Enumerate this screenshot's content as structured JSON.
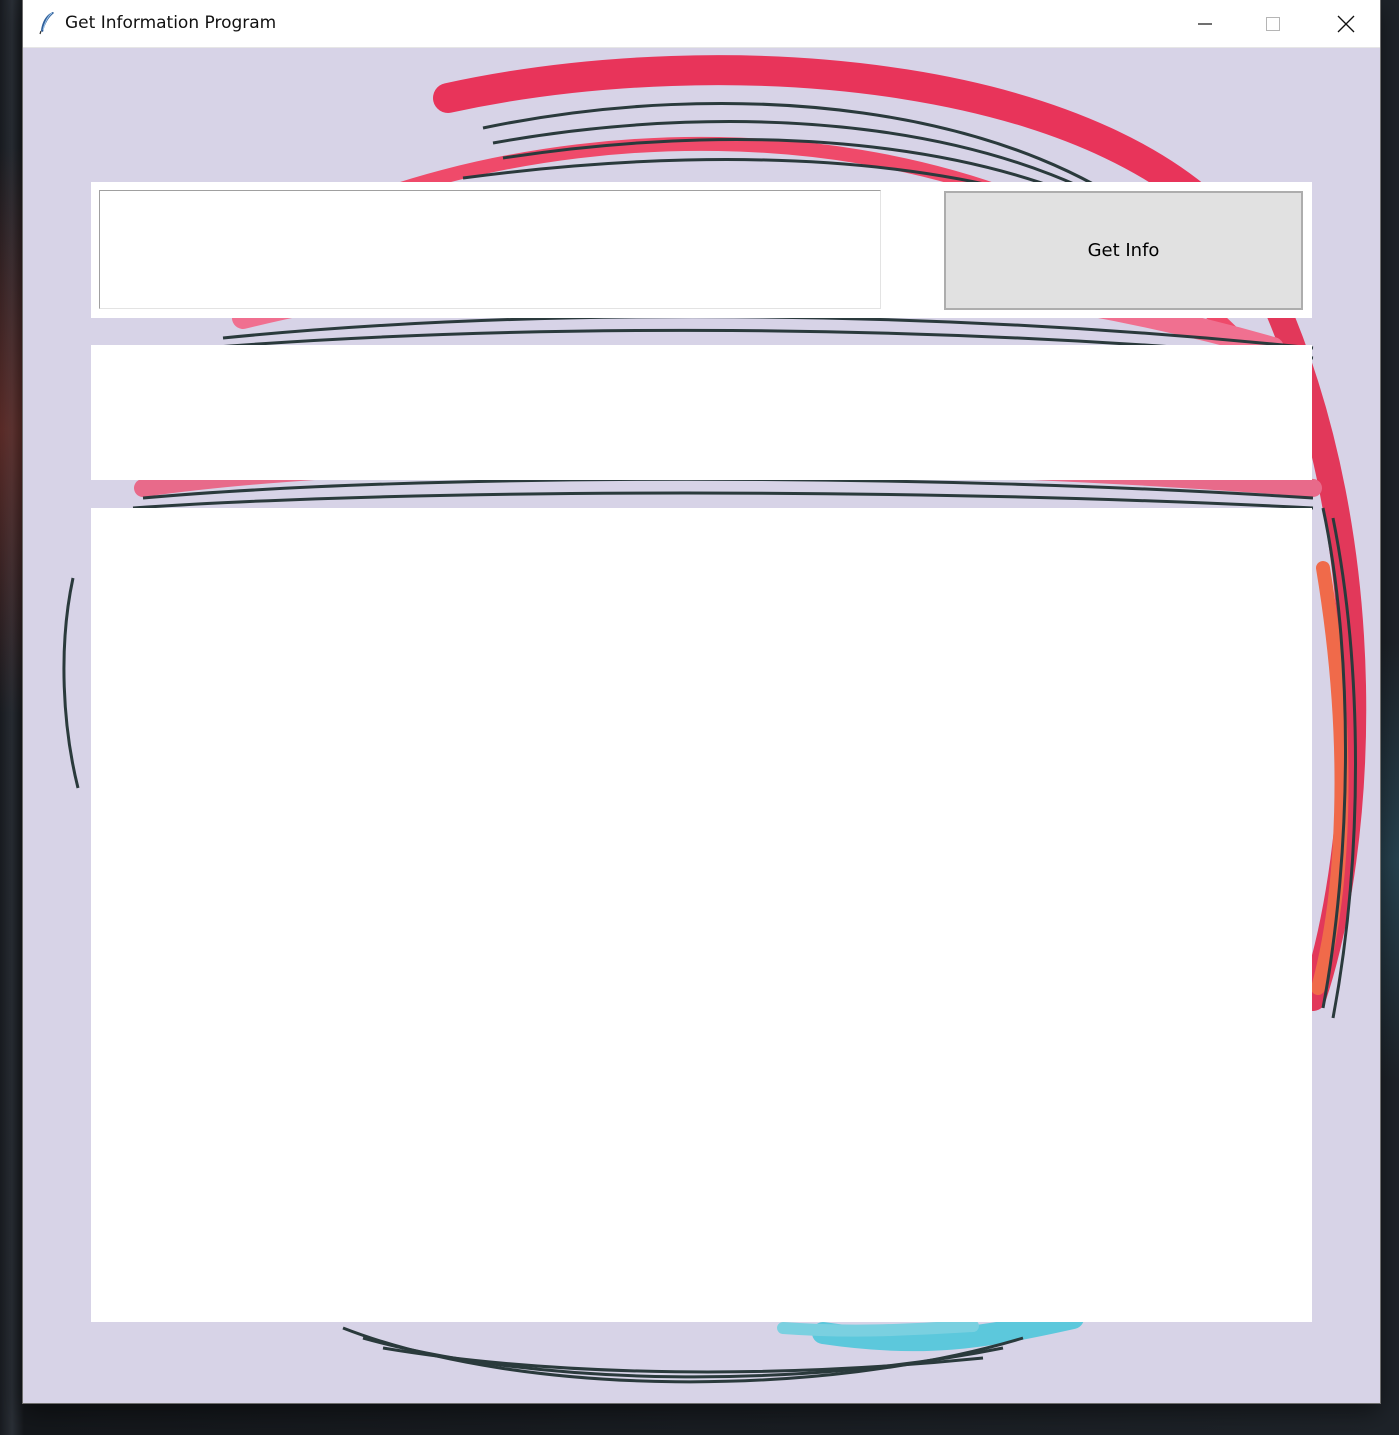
{
  "window": {
    "title": "Get Information Program",
    "icon": "feather-icon",
    "controls": [
      "minimize-icon",
      "maximize-icon",
      "close-icon"
    ]
  },
  "form": {
    "input_value": "",
    "button_label": "Get Info"
  },
  "output": {
    "label_text": "",
    "text_content": ""
  },
  "colors": {
    "background_art_base": "#d6d2e6",
    "art_red": "#e8345a",
    "art_pink": "#f06080",
    "art_dark": "#2a3a3c",
    "art_cyan": "#5cc8dc",
    "button_face": "#e1e1e1"
  }
}
